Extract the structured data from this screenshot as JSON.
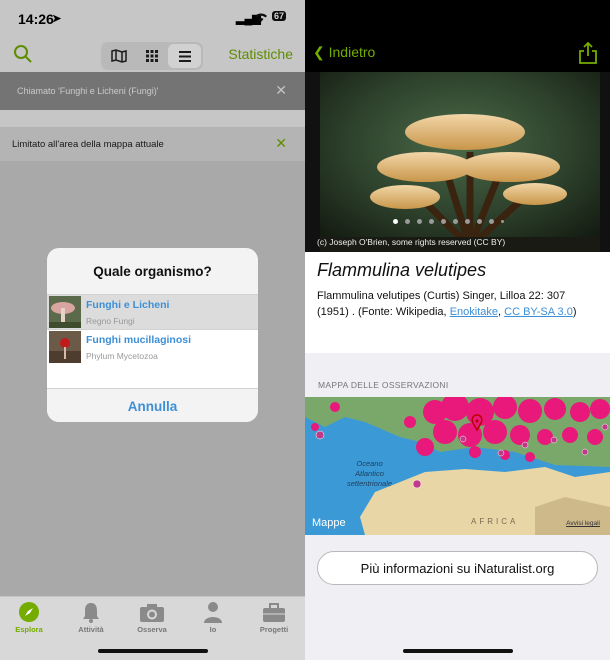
{
  "status": {
    "time": "14:26",
    "battery": "67"
  },
  "left": {
    "navbar": {
      "stats_label": "Statistiche",
      "view_icons": [
        "map-icon",
        "grid-icon",
        "list-icon"
      ]
    },
    "filters": [
      {
        "text": "Chiamato 'Funghi e Licheni (Fungi)'"
      },
      {
        "text": "Limitato all'area della mappa attuale"
      }
    ],
    "dialog": {
      "title": "Quale organismo?",
      "options": [
        {
          "name": "Funghi e Licheni",
          "rank": "Regno Fungi"
        },
        {
          "name": "Funghi mucillaginosi",
          "rank": "Phylum Mycetozoa"
        }
      ],
      "cancel": "Annulla"
    },
    "tabs": [
      {
        "label": "Esplora",
        "icon": "compass-icon"
      },
      {
        "label": "Attività",
        "icon": "bell-icon"
      },
      {
        "label": "Osserva",
        "icon": "camera-icon"
      },
      {
        "label": "Io",
        "icon": "person-icon"
      },
      {
        "label": "Progetti",
        "icon": "briefcase-icon"
      }
    ]
  },
  "right": {
    "back_label": "Indietro",
    "photo_credit": "(c) Joseph O'Brien, some rights reserved (CC BY)",
    "photo_count": 10,
    "photo_index": 1,
    "scientific_name": "Flammulina velutipes",
    "description": "Flammulina velutipes (Curtis) Singer, Lilloa 22: 307 (1951) . (Fonte: Wikipedia,",
    "link1": "Enokitake",
    "sep": ",",
    "link2": "CC BY-SA 3.0",
    "desc_end": ")",
    "map_header": "MAPPA DELLE OSSERVAZIONI",
    "map_labels": {
      "ocean": "Oceano",
      "ocean2": "Atlantico",
      "ocean3": "settentrionale",
      "africa": "AFRICA",
      "brand": "Mappe",
      "legal": "Avvisi legali"
    },
    "more_button": "Più informazioni su iNaturalist.org"
  },
  "colors": {
    "accent": "#74ac00",
    "link": "#3d8fd6",
    "obs": "#e8197a"
  }
}
